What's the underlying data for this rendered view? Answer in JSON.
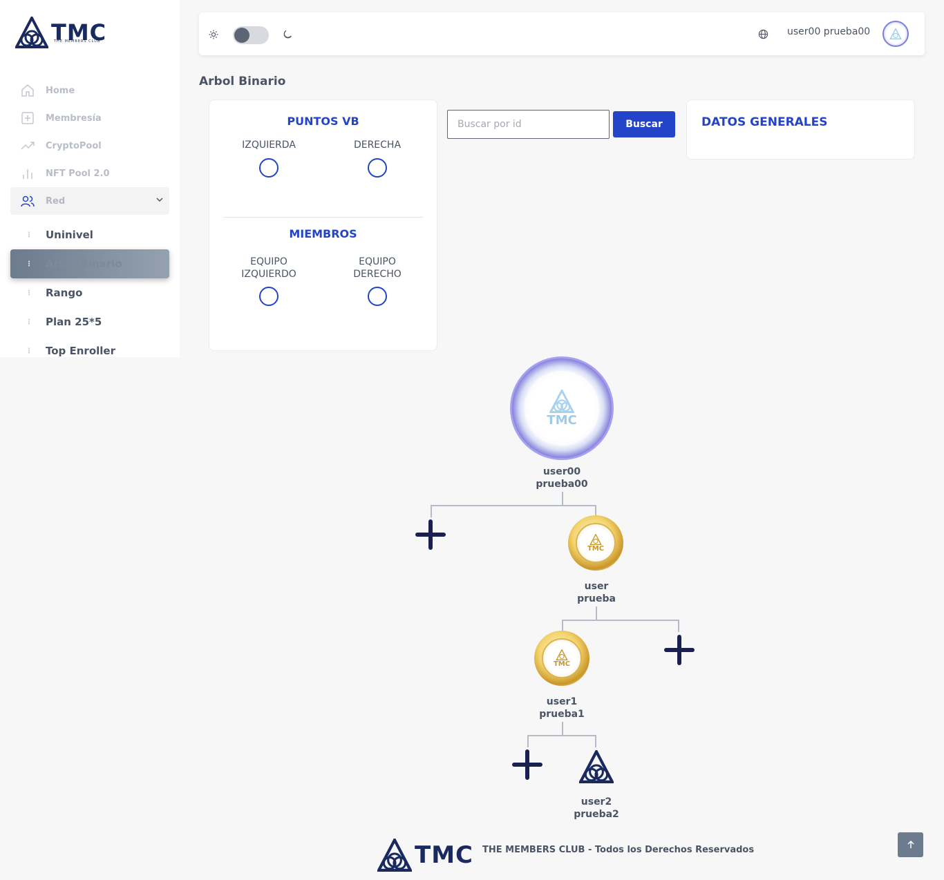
{
  "brand": {
    "name": "TMC",
    "tagline": "THE MEMBERS CLUB"
  },
  "sidebar": {
    "items": [
      {
        "label": "Home",
        "icon": "home-icon"
      },
      {
        "label": "Membresía",
        "icon": "plus-square-icon"
      },
      {
        "label": "CryptoPool",
        "icon": "trending-up-icon"
      },
      {
        "label": "NFT Pool 2.0",
        "icon": "bar-chart-icon"
      },
      {
        "label": "Red",
        "icon": "users-icon",
        "expanded": true
      }
    ],
    "subitems": [
      {
        "label": "Uninivel"
      },
      {
        "label": "Arbol Binario",
        "active": true
      },
      {
        "label": "Rango"
      },
      {
        "label": "Plan 25*5"
      },
      {
        "label": "Top Enroller"
      }
    ]
  },
  "topbar": {
    "username": "user00 prueba00",
    "theme": "light"
  },
  "page": {
    "title": "Arbol Binario"
  },
  "points": {
    "title": "PUNTOS VB",
    "left_label": "IZQUIERDA",
    "right_label": "DERECHA",
    "members_title": "MIEMBROS",
    "team_left": "EQUIPO IZQUIERDO",
    "team_right": "EQUIPO DERECHO"
  },
  "search": {
    "placeholder": "Buscar por id",
    "button": "Buscar"
  },
  "datos": {
    "title": "DATOS GENERALES"
  },
  "tree": {
    "root": {
      "first": "user00",
      "last": "prueba00",
      "rank": "royal-diamond"
    },
    "level1_right": {
      "first": "user",
      "last": "prueba",
      "rank": "gold"
    },
    "level2_left": {
      "first": "user1",
      "last": "prueba1",
      "rank": "gold"
    },
    "level3_right": {
      "first": "user2",
      "last": "prueba2",
      "rank": "basic"
    }
  },
  "footer": {
    "text": "THE MEMBERS CLUB - Todos los Derechos Reservados"
  },
  "colors": {
    "primary": "#2344c9",
    "navy": "#1a2a5e",
    "active": "#6c7b8d"
  }
}
